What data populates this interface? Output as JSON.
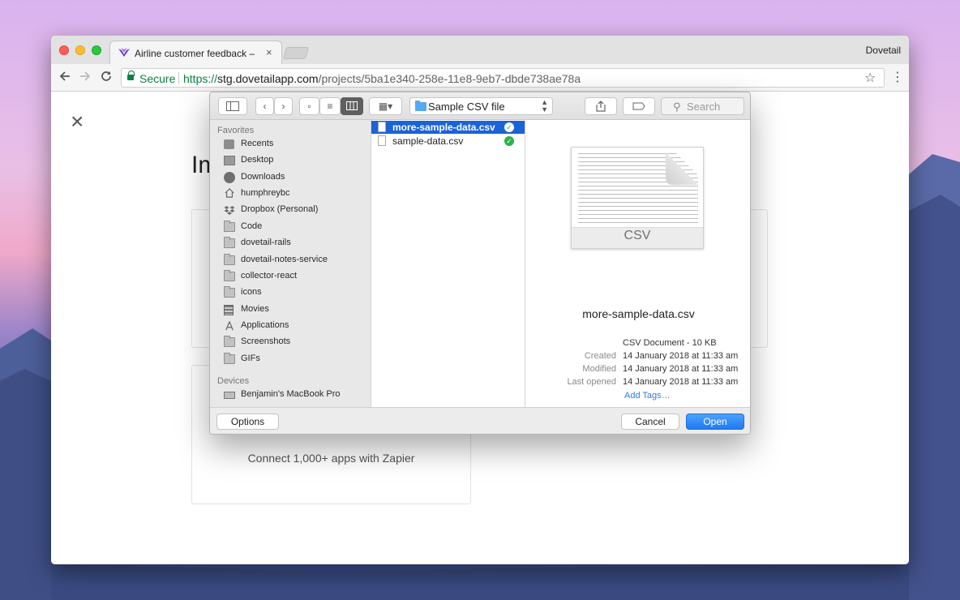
{
  "browser": {
    "tab_title": "Airline customer feedback – Dovetail",
    "tab_close": "×",
    "profile_name": "Dovetail",
    "secure_label": "Secure",
    "url_scheme": "https://",
    "url_host": "stg.dovetailapp.com",
    "url_path": "/projects/5ba1e340-258e-11e8-9eb7-dbde738ae78a",
    "icons": {
      "back": "arrow-left-icon",
      "forward": "arrow-right-icon",
      "reload": "reload-icon",
      "bookmark": "star-icon",
      "menu": "kebab-icon"
    }
  },
  "page": {
    "heading": "Im",
    "close": "×",
    "zapier_text": "Connect 1,000+ apps with Zapier"
  },
  "dialog": {
    "location": "Sample CSV file",
    "search_placeholder": "Search",
    "sidebar": {
      "favorites_header": "Favorites",
      "favorites": [
        {
          "label": "Recents",
          "icon": "recents-icon"
        },
        {
          "label": "Desktop",
          "icon": "desktop-icon"
        },
        {
          "label": "Downloads",
          "icon": "downloads-icon"
        },
        {
          "label": "humphreybc",
          "icon": "home-icon"
        },
        {
          "label": "Dropbox (Personal)",
          "icon": "dropbox-icon"
        },
        {
          "label": "Code",
          "icon": "folder-icon"
        },
        {
          "label": "dovetail-rails",
          "icon": "folder-icon"
        },
        {
          "label": "dovetail-notes-service",
          "icon": "folder-icon"
        },
        {
          "label": "collector-react",
          "icon": "folder-icon"
        },
        {
          "label": "icons",
          "icon": "folder-icon"
        },
        {
          "label": "Movies",
          "icon": "movies-icon"
        },
        {
          "label": "Applications",
          "icon": "applications-icon"
        },
        {
          "label": "Screenshots",
          "icon": "folder-icon"
        },
        {
          "label": "GIFs",
          "icon": "folder-icon"
        }
      ],
      "devices_header": "Devices",
      "devices": [
        {
          "label": "Benjamin's MacBook Pro",
          "icon": "laptop-icon"
        }
      ]
    },
    "files": [
      {
        "name": "more-sample-data.csv",
        "selected": true,
        "status": "synced"
      },
      {
        "name": "sample-data.csv",
        "selected": false,
        "status": "synced"
      }
    ],
    "preview": {
      "file_ext": "CSV",
      "name": "more-sample-data.csv",
      "kind": "CSV Document - 10 KB",
      "created_label": "Created",
      "created": "14 January 2018 at 11:33 am",
      "modified_label": "Modified",
      "modified": "14 January 2018 at 11:33 am",
      "last_opened_label": "Last opened",
      "last_opened": "14 January 2018 at 11:33 am",
      "add_tags": "Add Tags…"
    },
    "buttons": {
      "options": "Options",
      "cancel": "Cancel",
      "open": "Open"
    },
    "colors": {
      "selection": "#1a63d8",
      "primary_button": "#1f7bf2",
      "check": "#2bb24c"
    }
  }
}
